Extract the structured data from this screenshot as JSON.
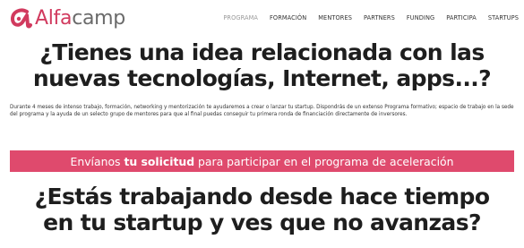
{
  "brand": {
    "name_part1": "Alfa",
    "name_part2": "camp",
    "accent_color": "#df4a6d",
    "logo_icon": "alfa-symbol-icon"
  },
  "nav": {
    "items": [
      {
        "label": "PROGRAMA",
        "active": true
      },
      {
        "label": "FORMACIÓN",
        "active": false
      },
      {
        "label": "MENTORES",
        "active": false
      },
      {
        "label": "PARTNERS",
        "active": false
      },
      {
        "label": "FUNDING",
        "active": false
      },
      {
        "label": "PARTICIPA",
        "active": false
      },
      {
        "label": "STARTUPS",
        "active": false
      }
    ]
  },
  "hero": {
    "title": "¿Tienes una idea relacionada con las nuevas tecnologías, Internet, apps...?",
    "description": "Durante 4 meses de intenso trabajo, formación, networking y mentorización te ayudaremos a crear o lanzar tu startup. Dispondrás de un extenso Programa formativo; espacio de trabajo en la sede del programa y la ayuda de un selecto grupo de mentores para que al final puedas conseguir tu primera ronda de financiación directamente de inversores."
  },
  "cta": {
    "text_before": "Envíanos ",
    "text_bold": "tu solicitud",
    "text_after": " para participar en el programa de aceleración"
  },
  "section2": {
    "title": "¿Estás trabajando desde hace tiempo en tu startup y ves que no avanzas?"
  }
}
